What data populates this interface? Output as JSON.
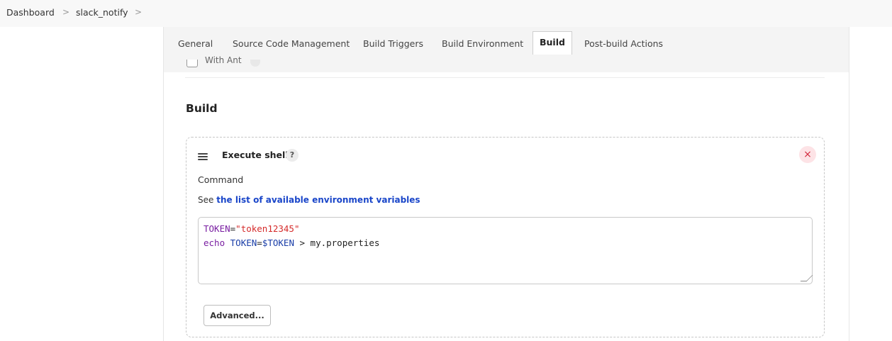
{
  "breadcrumb": {
    "items": [
      "Dashboard",
      "slack_notify"
    ],
    "separator": ">"
  },
  "tabs": [
    {
      "label": "General",
      "active": false
    },
    {
      "label": "Source Code Management",
      "active": false
    },
    {
      "label": "Build Triggers",
      "active": false
    },
    {
      "label": "Build Environment",
      "active": false
    },
    {
      "label": "Build",
      "active": true
    },
    {
      "label": "Post-build Actions",
      "active": false
    }
  ],
  "peek": {
    "text": "With Ant"
  },
  "section": {
    "title": "Build"
  },
  "step": {
    "title": "Execute shell",
    "help": "?",
    "close": "×",
    "command_label": "Command",
    "see_prefix": "See",
    "see_link": "the list of available environment variables",
    "command_lines": [
      "TOKEN=\"token12345\"",
      "echo TOKEN=$TOKEN > my.properties"
    ],
    "advanced_label": "Advanced..."
  },
  "colors": {
    "link": "#1a46c9",
    "close_bg": "#fde3e6",
    "close_fg": "#d3293d"
  }
}
